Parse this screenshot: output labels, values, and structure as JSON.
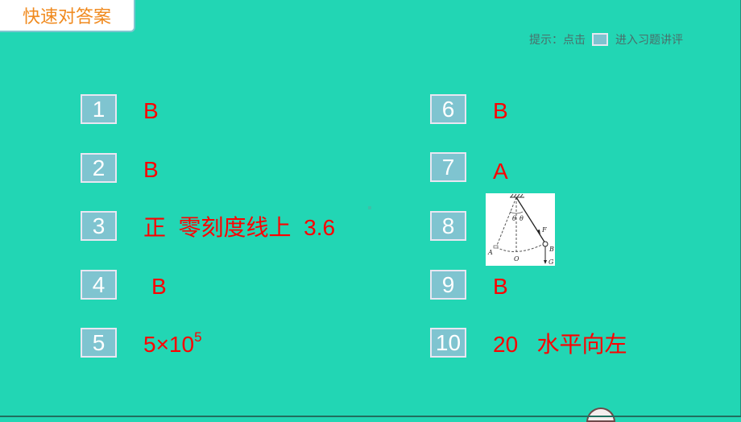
{
  "header": {
    "title": "快速对答案"
  },
  "hint": {
    "prefix": "提示：点击",
    "suffix": "进入习题讲评"
  },
  "questions": [
    {
      "num": "1",
      "answer": "B"
    },
    {
      "num": "2",
      "answer": "B"
    },
    {
      "num": "3",
      "answer": "正  零刻度线上  3.6"
    },
    {
      "num": "4",
      "answer": "B"
    },
    {
      "num": "5",
      "answer_base": "5×10",
      "answer_exp": "5"
    },
    {
      "num": "6",
      "answer": "B"
    },
    {
      "num": "7",
      "answer": "A"
    },
    {
      "num": "8",
      "answer_figure": "pendulum-force-diagram",
      "figure_labels": [
        "θ",
        "θ",
        "F",
        "A",
        "O",
        "B",
        "G"
      ]
    },
    {
      "num": "9",
      "answer": "B"
    },
    {
      "num": "10",
      "answer": "20   水平向左"
    }
  ],
  "colors": {
    "background": "#22d6b4",
    "title_text": "#f08a1e",
    "answer_text": "#ff0000",
    "number_box": "#7fc4d0"
  }
}
